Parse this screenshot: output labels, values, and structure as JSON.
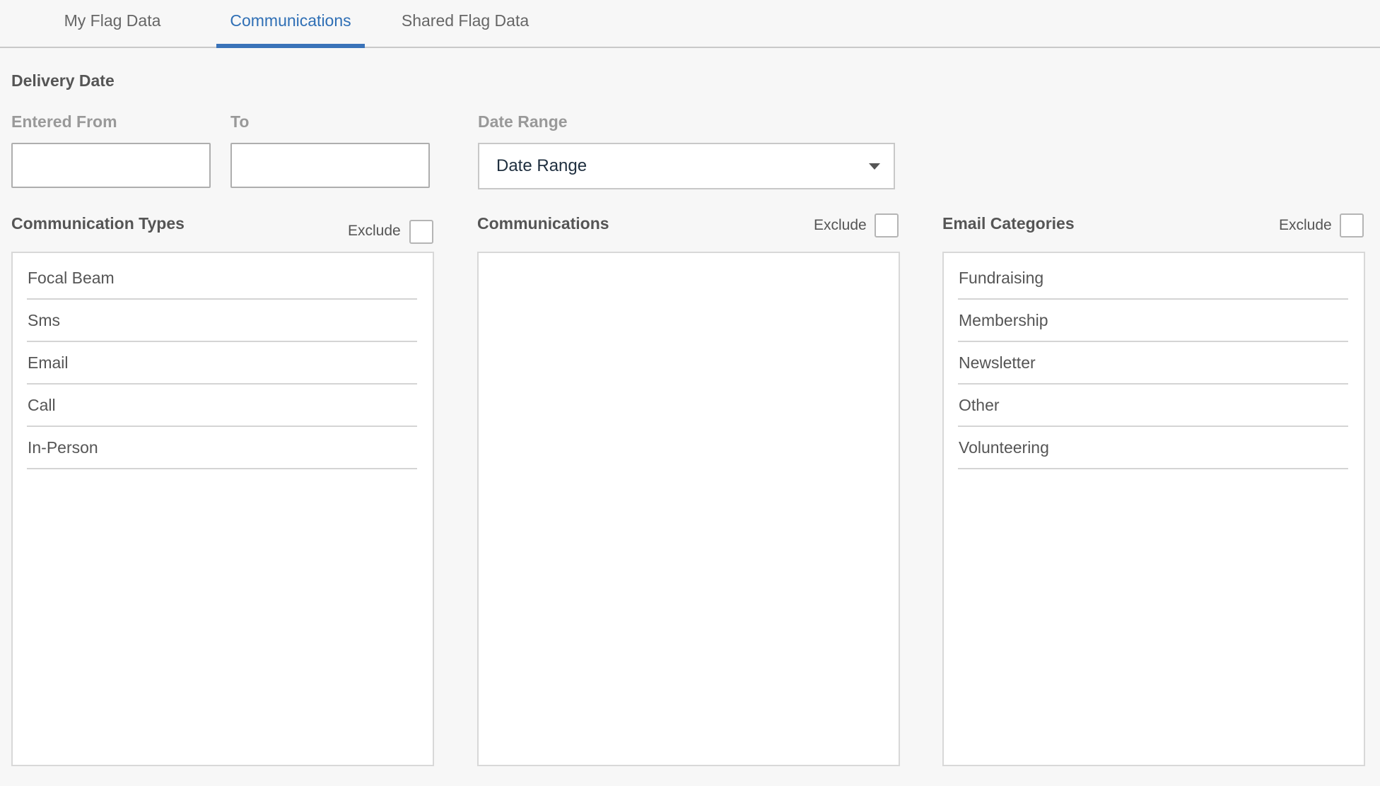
{
  "tabs": [
    {
      "label": "My Flag Data"
    },
    {
      "label": "Communications"
    },
    {
      "label": "Shared Flag Data"
    }
  ],
  "active_tab": "Communications",
  "delivery_date": {
    "title": "Delivery Date",
    "entered_from": {
      "label": "Entered From",
      "value": ""
    },
    "to": {
      "label": "To",
      "value": ""
    },
    "date_range": {
      "label": "Date Range",
      "selected": "Date Range"
    }
  },
  "panels": {
    "communication_types": {
      "title": "Communication Types",
      "exclude_label": "Exclude",
      "items": [
        "Focal Beam",
        "Sms",
        "Email",
        "Call",
        "In-Person"
      ]
    },
    "communications": {
      "title": "Communications",
      "exclude_label": "Exclude",
      "items": []
    },
    "email_categories": {
      "title": "Email Categories",
      "exclude_label": "Exclude",
      "items": [
        "Fundraising",
        "Membership",
        "Newsletter",
        "Other",
        "Volunteering"
      ]
    }
  },
  "colors": {
    "accent": "#2f6fb5",
    "tab_underline": "#3a73b9",
    "background": "#f7f7f7"
  }
}
